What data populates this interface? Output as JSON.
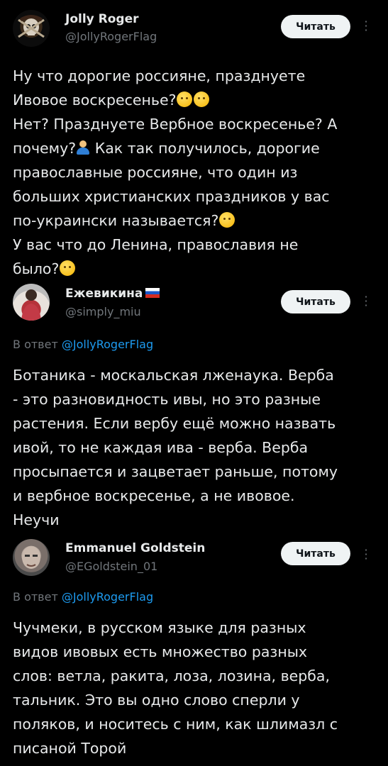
{
  "follow_label": "Читать",
  "posts": [
    {
      "author": "Jolly Roger",
      "handle": "@JollyRogerFlag",
      "lines": [
        "Ну что дорогие россияне, празднуете",
        "Ивовое воскресенье?",
        "Нет? Празднуете Вербное воскресенье? А",
        "почему?",
        "Как так получилось, дорогие",
        "православные россияне, что один из",
        "больших христианских праздников у вас",
        "по-украински называется?",
        "У вас что до Ленина, православия не",
        "было?"
      ]
    },
    {
      "author": "Ежевикина",
      "handle": "@simply_miu",
      "reply_prefix": "В ответ",
      "reply_mention": "@JollyRogerFlag",
      "lines": [
        "Ботаника - москальская лженаука. Верба",
        "- это разновидность ивы, но это разные",
        "растения. Если вербу ещё можно назвать",
        "ивой, то не каждая ива - верба. Верба",
        "просыпается и зацветает раньше, потому",
        "и вербное воскресенье, а не ивовое.",
        "Неучи"
      ]
    },
    {
      "author": "Emmanuel Goldstein",
      "handle": "@EGoldstein_01",
      "reply_prefix": "В ответ",
      "reply_mention": "@JollyRogerFlag",
      "lines": [
        "Чучмеки, в русском языке для разных",
        "видов ивовых есть множество разных",
        "слов: ветла, ракита, лоза, лозина, верба,",
        "тальник. Это вы одно слово сперли у",
        "поляков, и носитесь с ним, как шлимазл с",
        "писаной Торой"
      ]
    }
  ],
  "colors": {
    "background": "#000000",
    "text": "#e7e9ea",
    "secondary": "#71767b",
    "mention": "#1d9bf0",
    "button_bg": "#eff3f4"
  }
}
